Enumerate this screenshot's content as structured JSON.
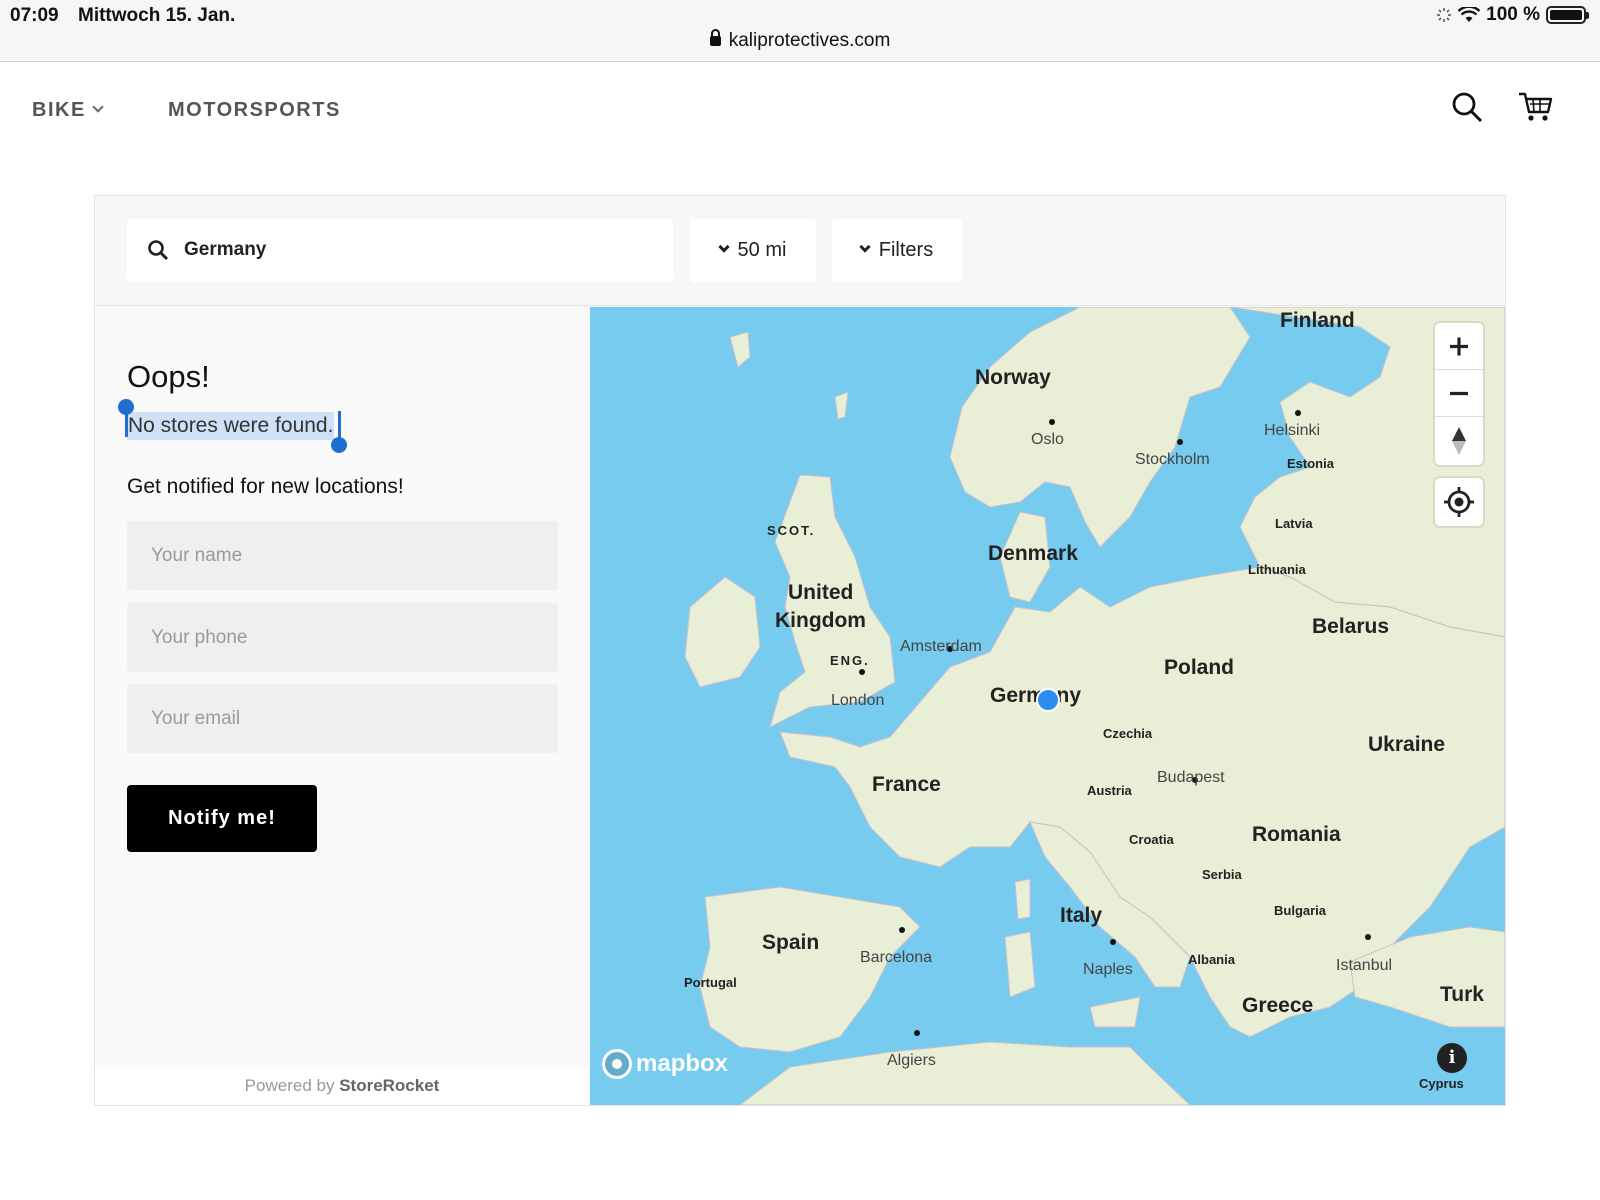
{
  "status_bar": {
    "time": "07:09",
    "date": "Mittwoch 15. Jan.",
    "battery": "100 %",
    "url": "kaliprotectives.com"
  },
  "nav": {
    "items": [
      {
        "label": "BIKE"
      },
      {
        "label": "MOTORSPORTS"
      }
    ]
  },
  "search": {
    "value": "Germany",
    "radius": "50 mi",
    "filters": "Filters"
  },
  "results": {
    "title": "Oops!",
    "message": "No stores were found.",
    "notify_title": "Get notified for new locations!",
    "name_placeholder": "Your name",
    "phone_placeholder": "Your phone",
    "email_placeholder": "Your email",
    "button": "Notify me!",
    "powered_by": "Powered by",
    "powered_brand": "StoreRocket"
  },
  "map": {
    "attribution": "mapbox",
    "info": "i",
    "labels": {
      "finland": "Finland",
      "norway": "Norway",
      "oslo": "Oslo",
      "stockholm": "Stockholm",
      "helsinki": "Helsinki",
      "estonia": "Estonia",
      "latvia": "Latvia",
      "lithuania": "Lithuania",
      "scot": "SCOT.",
      "denmark": "Denmark",
      "uk1": "United",
      "uk2": "Kingdom",
      "belarus": "Belarus",
      "amsterdam": "Amsterdam",
      "eng": "ENG.",
      "poland": "Poland",
      "london": "London",
      "germany": "Germany",
      "czechia": "Czechia",
      "ukraine": "Ukraine",
      "budapest": "Budapest",
      "france": "France",
      "austria": "Austria",
      "croatia": "Croatia",
      "romania": "Romania",
      "serbia": "Serbia",
      "italy": "Italy",
      "bulgaria": "Bulgaria",
      "spain": "Spain",
      "barcelona": "Barcelona",
      "naples": "Naples",
      "albania": "Albania",
      "istanbul": "Istanbul",
      "portugal": "Portugal",
      "greece": "Greece",
      "turkey": "Turk",
      "algiers": "Algiers",
      "cyprus": "Cyprus"
    }
  },
  "colors": {
    "water": "#76cbef",
    "land": "#e9eed7",
    "selection": "#1f6fd1",
    "marker": "#2d8cf0",
    "button": "#000000"
  }
}
